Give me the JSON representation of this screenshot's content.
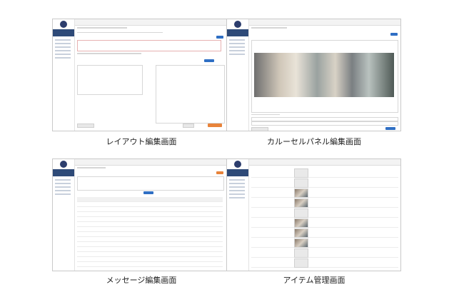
{
  "captions": {
    "layout_edit": "レイアウト編集画面",
    "carousel_edit": "カルーセルパネル編集画面",
    "message_edit": "メッセージ編集画面",
    "item_manage": "アイテム管理画面"
  }
}
